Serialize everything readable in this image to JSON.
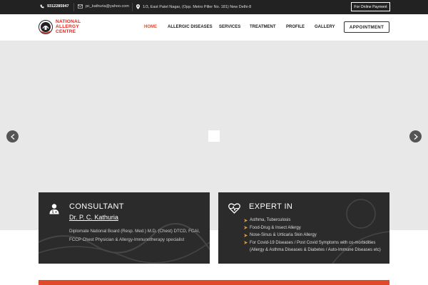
{
  "topbar": {
    "phone": "9312285947",
    "email": "pc_kathuria@yahoo.com",
    "address": "1/3, East Patel Nagar, (Opp. Metro Piller No. 181) New Delhi-8",
    "payment_label": "For Online Payment"
  },
  "logo": {
    "line1": "NATIONAL",
    "line2": "ALLERGY",
    "line3": "CENTRE"
  },
  "nav": {
    "items": [
      {
        "label": "HOME",
        "active": true
      },
      {
        "label": "ALLERGIC DISEASES"
      },
      {
        "label": "SERVICES"
      },
      {
        "label": "TREATMENT"
      },
      {
        "label": "PROFILE"
      },
      {
        "label": "GALLERY"
      }
    ],
    "appointment_label": "APPOINTMENT"
  },
  "consultant": {
    "title": "CONSULTANT",
    "name": "Dr. P. C. Kathuria",
    "description": "Diplomate National Board (Resp. Med.) M.D. (Chest) DTCD, FCAI, FCCP Chest Physician & Allergy-Immunotherapy specialist"
  },
  "expert": {
    "title": "EXPERT IN",
    "items": [
      "Asthma, Tuberculosis",
      "Food-Drug & Insect Allergy",
      "Nose-Sinus & Urticaria Skin Allergy",
      "For Covid-19 Diseases / Post Covid Symptoms with co-morbidities (Allergy & Asthma Diseases & Diabetes / Auto-Immune Diseases etc)"
    ]
  },
  "colors": {
    "accent": "#e04a2b",
    "brand_red": "#e0261f",
    "dark": "#222222"
  }
}
